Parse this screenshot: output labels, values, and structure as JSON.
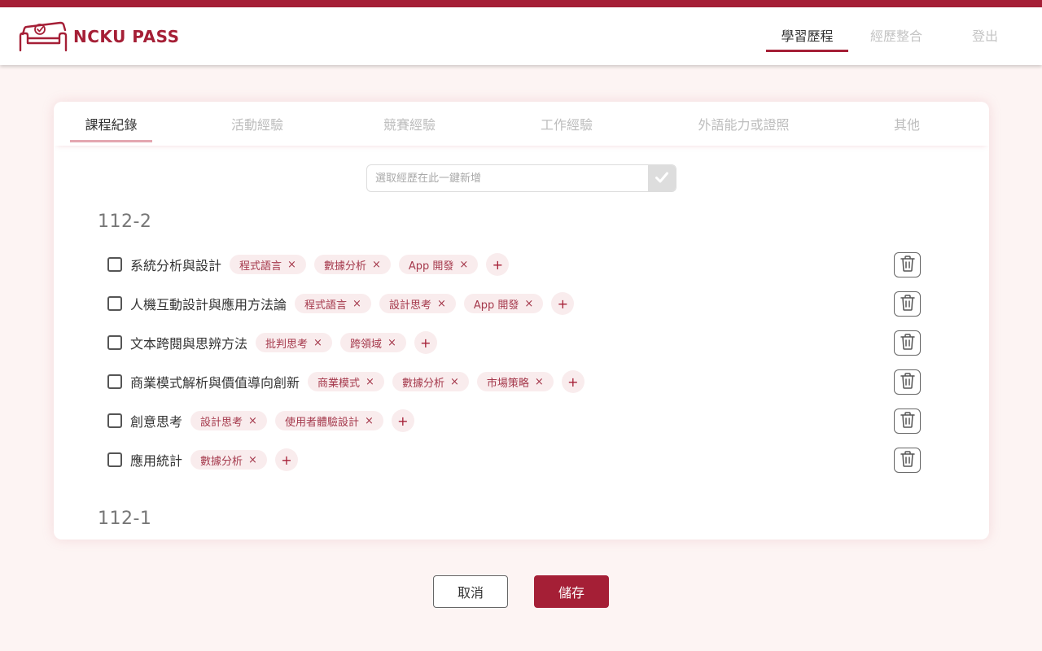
{
  "brand": {
    "name": "NCKU PASS",
    "color": "#a51f36",
    "logo_icon": "sofa-check-icon"
  },
  "nav": {
    "items": [
      {
        "label": "學習歷程",
        "active": true
      },
      {
        "label": "經歷整合",
        "active": false
      },
      {
        "label": "登出",
        "active": false
      }
    ]
  },
  "tabs": [
    {
      "label": "課程紀錄",
      "active": true
    },
    {
      "label": "活動經驗",
      "active": false
    },
    {
      "label": "競賽經驗",
      "active": false
    },
    {
      "label": "工作經驗",
      "active": false
    },
    {
      "label": "外語能力或證照",
      "active": false
    },
    {
      "label": "其他",
      "active": false
    }
  ],
  "quick_add": {
    "placeholder": "選取經歷在此一鍵新增",
    "icon": "check-icon"
  },
  "terms": [
    {
      "title": "112-2",
      "courses": [
        {
          "name": "系統分析與設計",
          "checked": false,
          "tags": [
            "程式語言",
            "數據分析",
            "App 開發"
          ]
        },
        {
          "name": "人機互動設計與應用方法論",
          "checked": false,
          "tags": [
            "程式語言",
            "設計思考",
            "App 開發"
          ]
        },
        {
          "name": "文本跨閱與思辨方法",
          "checked": false,
          "tags": [
            "批判思考",
            "跨領域"
          ]
        },
        {
          "name": "商業模式解析與價值導向創新",
          "checked": false,
          "tags": [
            "商業模式",
            "數據分析",
            "市場策略"
          ]
        },
        {
          "name": "創意思考",
          "checked": false,
          "tags": [
            "設計思考",
            "使用者體驗設計"
          ]
        },
        {
          "name": "應用統計",
          "checked": false,
          "tags": [
            "數據分析"
          ]
        }
      ]
    },
    {
      "title": "112-1",
      "courses": []
    }
  ],
  "icons": {
    "tag_remove": "×",
    "add_tag": "+",
    "delete": "trash-icon"
  },
  "actions": {
    "cancel_label": "取消",
    "save_label": "儲存"
  },
  "colors": {
    "accent": "#a51f36",
    "tag_bg": "#f9eced",
    "page_bg": "#fdf4f3"
  }
}
